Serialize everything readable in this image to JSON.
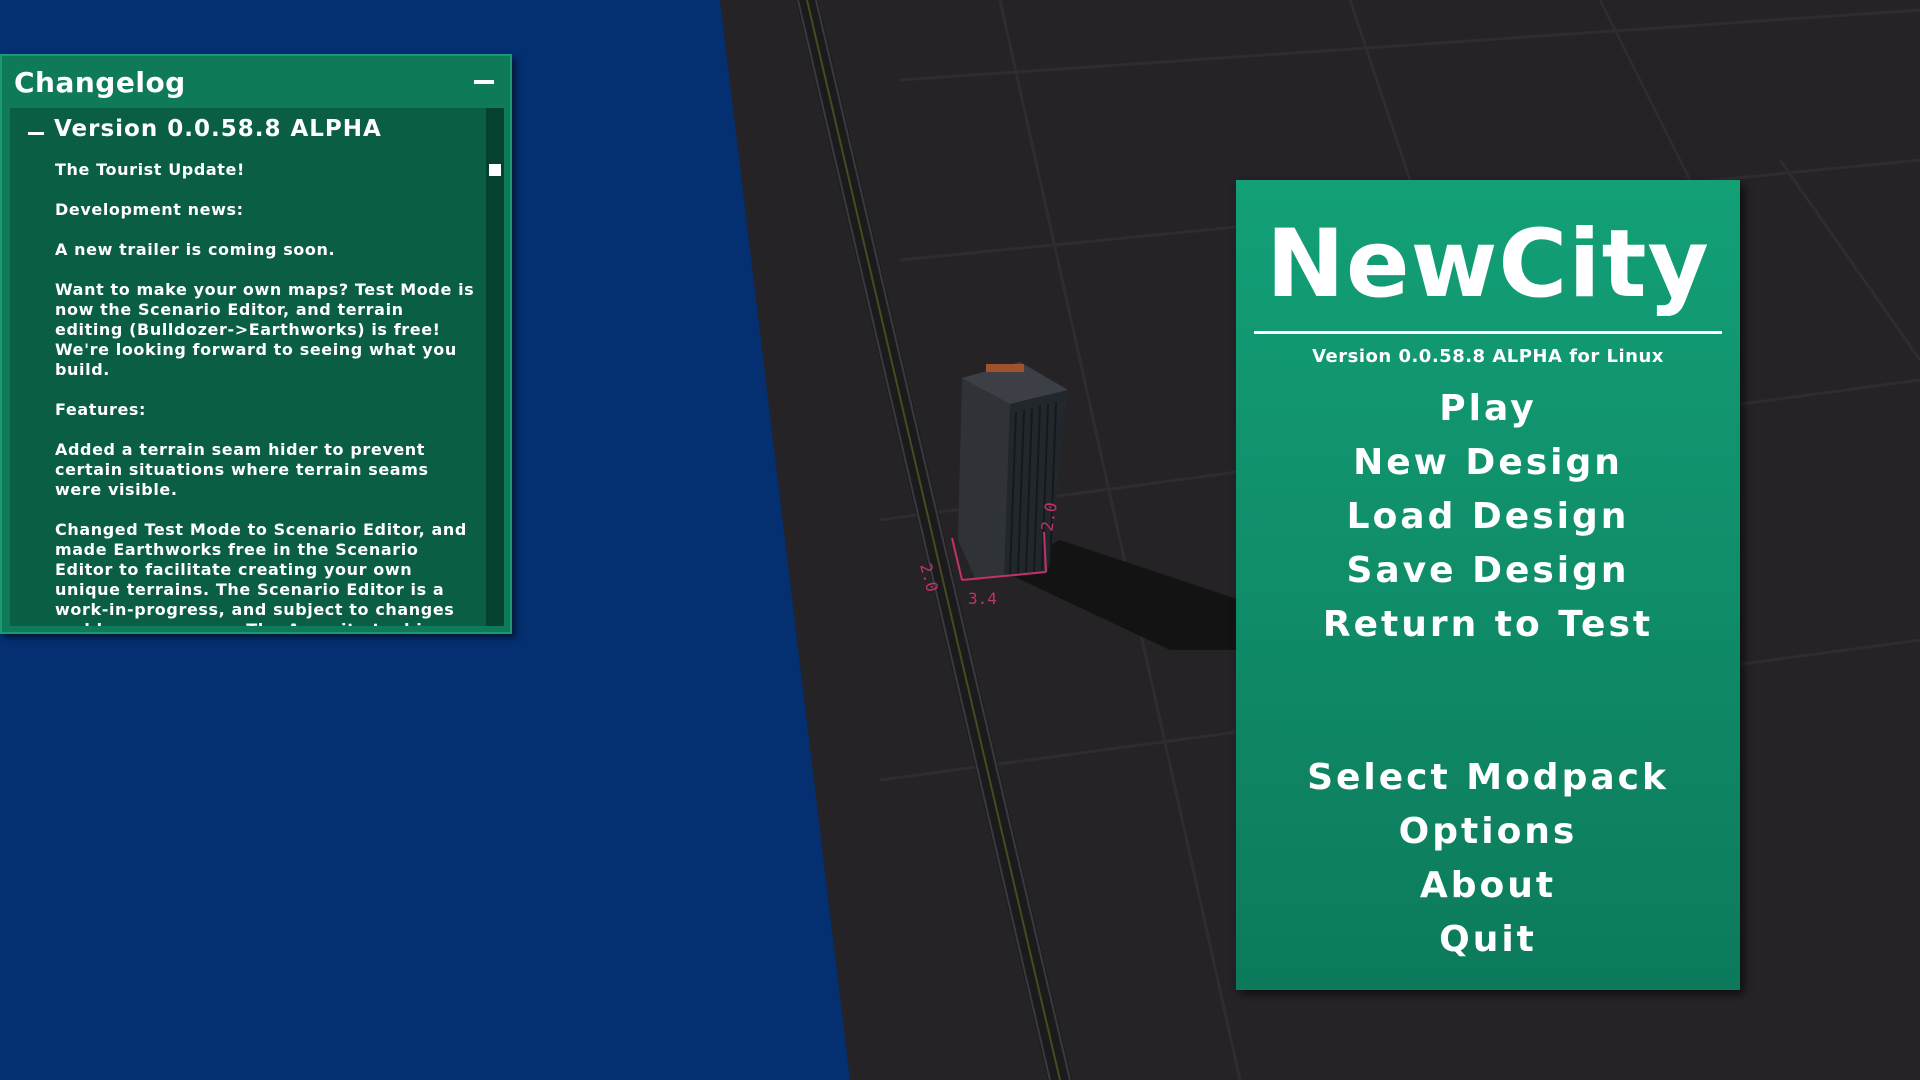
{
  "changelog": {
    "title": "Changelog",
    "version_heading": "Version 0.0.58.8 ALPHA",
    "entries": [
      "The Tourist Update!",
      "Development news:",
      "A new trailer is coming soon.",
      "Want to make your own maps? Test Mode is now the Scenario Editor, and terrain editing (Bulldozer->Earthworks) is free! We're looking forward to seeing what you build.",
      "Features:",
      "Added a terrain seam hider to prevent certain situations where terrain seams were visible.",
      "Changed Test Mode to Scenario Editor, and made Earthworks free in the Scenario Editor to facilitate creating your own unique terrains. The Scenario Editor is a work-in-progress, and subject to changes and bugs as we go. The Amenity tool is currently disabled in the Scenario Editor."
    ]
  },
  "menu": {
    "title": "NewCity",
    "version": "Version 0.0.58.8 ALPHA for Linux",
    "items": [
      "Play",
      "New Design",
      "Load Design",
      "Save Design",
      "Return to Test",
      "Select Modpack",
      "Options",
      "About",
      "Quit"
    ]
  },
  "scene": {
    "labels": [
      "2.0",
      "2.0",
      "3.4"
    ]
  },
  "colors": {
    "sky": "#042f70",
    "panel": "#0e7a5a",
    "menu": "#13a077",
    "ground": "#252325"
  }
}
